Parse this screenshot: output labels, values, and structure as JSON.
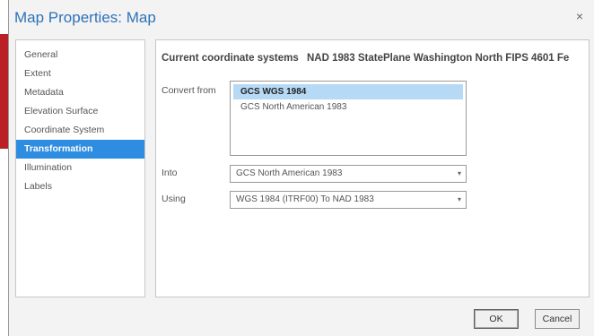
{
  "window": {
    "title": "Map Properties: Map",
    "close_glyph": "×"
  },
  "nav": {
    "items": [
      "General",
      "Extent",
      "Metadata",
      "Elevation Surface",
      "Coordinate System",
      "Transformation",
      "Illumination",
      "Labels"
    ],
    "selected": "Transformation"
  },
  "content": {
    "current_label": "Current coordinate systems",
    "current_value": "NAD 1983 StatePlane Washington North FIPS 4601 Fe",
    "convert_from_label": "Convert from",
    "convert_from_items": [
      "GCS WGS 1984",
      "GCS North American 1983"
    ],
    "convert_from_selected": "GCS WGS 1984",
    "into_label": "Into",
    "into_value": "GCS North American 1983",
    "using_label": "Using",
    "using_value": "WGS 1984 (ITRF00) To NAD 1983"
  },
  "buttons": {
    "ok": "OK",
    "cancel": "Cancel"
  },
  "colors": {
    "accent": "#2e73b8",
    "selection": "#2e8de0",
    "list_selection": "#b6d9f5",
    "side_strip": "#b92126"
  }
}
